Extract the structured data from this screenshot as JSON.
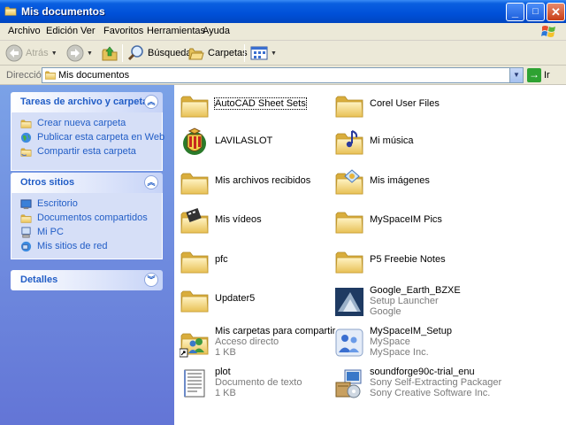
{
  "window": {
    "title": "Mis documentos",
    "buttons": {
      "minimize": "_",
      "maximize": "□",
      "close": "✕"
    }
  },
  "menu": [
    "Archivo",
    "Edición",
    "Ver",
    "Favoritos",
    "Herramientas",
    "Ayuda"
  ],
  "toolbar": {
    "back_label": "Atrás",
    "search_label": "Búsqueda",
    "folders_label": "Carpetas"
  },
  "address": {
    "label": "Dirección",
    "value": "Mis documentos",
    "go_label": "Ir"
  },
  "taskpane": {
    "file_tasks": {
      "title": "Tareas de archivo y carpeta",
      "items": [
        "Crear nueva carpeta",
        "Publicar esta carpeta en Web",
        "Compartir esta carpeta"
      ]
    },
    "other_places": {
      "title": "Otros sitios",
      "items": [
        "Escritorio",
        "Documentos compartidos",
        "Mi PC",
        "Mis sitios de red"
      ]
    },
    "details": {
      "title": "Detalles"
    }
  },
  "files": [
    {
      "name": "AutoCAD Sheet Sets",
      "icon": "folder-icon"
    },
    {
      "name": "Corel User Files",
      "icon": "folder-icon"
    },
    {
      "name": "LAVILASLOT",
      "icon": "crest-icon"
    },
    {
      "name": "Mi música",
      "icon": "music-folder-icon"
    },
    {
      "name": "Mis archivos recibidos",
      "icon": "folder-icon"
    },
    {
      "name": "Mis imágenes",
      "icon": "pictures-folder-icon"
    },
    {
      "name": "Mis vídeos",
      "icon": "videos-folder-icon"
    },
    {
      "name": "MySpaceIM Pics",
      "icon": "folder-icon"
    },
    {
      "name": "pfc",
      "icon": "folder-icon"
    },
    {
      "name": "P5 Freebie Notes",
      "icon": "folder-icon"
    },
    {
      "name": "Updater5",
      "icon": "folder-icon"
    },
    {
      "name": "Google_Earth_BZXE",
      "sub1": "Setup Launcher",
      "sub2": "Google",
      "icon": "google-earth-icon"
    },
    {
      "name": "Mis carpetas para compartir",
      "sub1": "Acceso directo",
      "sub2": "1 KB",
      "icon": "shared-folder-shortcut-icon"
    },
    {
      "name": "MySpaceIM_Setup",
      "sub1": "MySpace",
      "sub2": "MySpace Inc.",
      "icon": "myspace-setup-icon"
    },
    {
      "name": "plot",
      "sub1": "Documento de texto",
      "sub2": "1 KB",
      "icon": "text-document-icon"
    },
    {
      "name": "soundforge90c-trial_enu",
      "sub1": "Sony Self-Extracting Packager",
      "sub2": "Sony Creative Software Inc.",
      "icon": "installer-package-icon"
    }
  ],
  "colors": {
    "titlebar": "#0050d8",
    "taskpane_link": "#215dc6",
    "taskpane_bg": "#7ba2e7",
    "folder": "#f5d77b"
  }
}
